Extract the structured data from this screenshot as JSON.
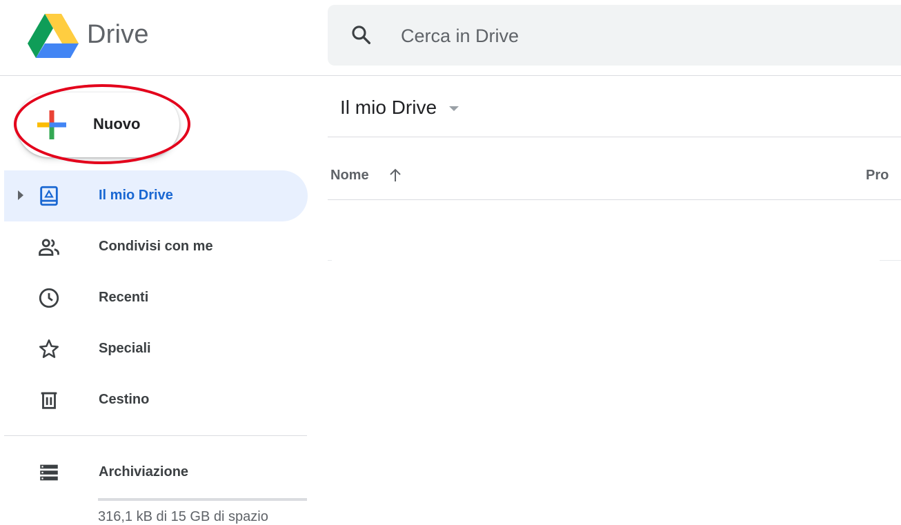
{
  "header": {
    "app_name": "Drive",
    "logo_icon": "google-drive-logo",
    "search": {
      "placeholder": "Cerca in Drive",
      "value": "",
      "icon": "search-icon"
    }
  },
  "sidebar": {
    "new_button": {
      "label": "Nuovo",
      "icon": "colorful-plus-icon"
    },
    "highlight_color": "#e3001b",
    "items": [
      {
        "label": "Il mio Drive",
        "icon": "my-drive-icon",
        "active": true
      },
      {
        "label": "Condivisi con me",
        "icon": "shared-people-icon",
        "active": false
      },
      {
        "label": "Recenti",
        "icon": "clock-icon",
        "active": false
      },
      {
        "label": "Speciali",
        "icon": "star-icon",
        "active": false
      },
      {
        "label": "Cestino",
        "icon": "trash-icon",
        "active": false
      }
    ],
    "storage": {
      "label": "Archiviazione",
      "icon": "storage-icon",
      "usage_text": "316,1 kB di 15 GB di spazio",
      "usage_fraction": 2e-05
    }
  },
  "main": {
    "breadcrumb": "Il mio Drive",
    "columns": {
      "name": "Nome",
      "owner": "Pro"
    },
    "sort": "ascending"
  },
  "colors": {
    "accent": "#1a73e8",
    "active_bg": "#e8f0fe",
    "active_text": "#1967d2"
  }
}
